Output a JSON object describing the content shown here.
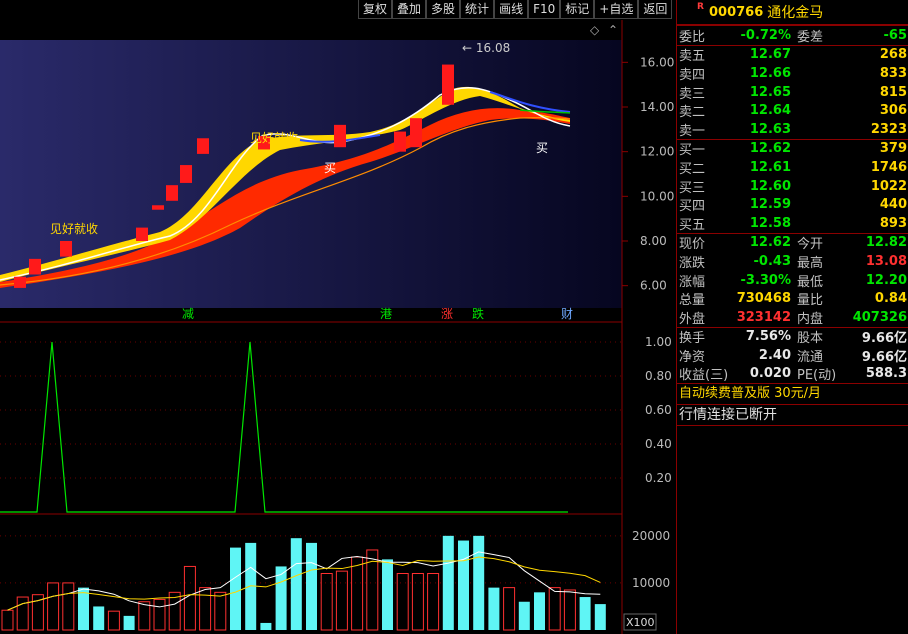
{
  "toolbar": [
    {
      "name": "tb-fuquan",
      "label": "复权"
    },
    {
      "name": "tb-diejia",
      "label": "叠加"
    },
    {
      "name": "tb-duogu",
      "label": "多股"
    },
    {
      "name": "tb-tongji",
      "label": "统计"
    },
    {
      "name": "tb-huaxian",
      "label": "画线"
    },
    {
      "name": "tb-f10",
      "label": "F10"
    },
    {
      "name": "tb-biaoji",
      "label": "标记"
    },
    {
      "name": "tb-zixuan",
      "label": "+自选"
    },
    {
      "name": "tb-fanhui",
      "label": "返回"
    }
  ],
  "stock": {
    "badge": "R",
    "code": "000766",
    "name": "通化金马"
  },
  "weibi": {
    "l1": "委比",
    "v1": "-0.72%",
    "l2": "委差",
    "v2": "-65"
  },
  "asks": [
    {
      "label": "卖五",
      "price": "12.67",
      "vol": "268"
    },
    {
      "label": "卖四",
      "price": "12.66",
      "vol": "833"
    },
    {
      "label": "卖三",
      "price": "12.65",
      "vol": "815"
    },
    {
      "label": "卖二",
      "price": "12.64",
      "vol": "306"
    },
    {
      "label": "卖一",
      "price": "12.63",
      "vol": "2323"
    }
  ],
  "bids": [
    {
      "label": "买一",
      "price": "12.62",
      "vol": "379"
    },
    {
      "label": "买二",
      "price": "12.61",
      "vol": "1746"
    },
    {
      "label": "买三",
      "price": "12.60",
      "vol": "1022"
    },
    {
      "label": "买四",
      "price": "12.59",
      "vol": "440"
    },
    {
      "label": "买五",
      "price": "12.58",
      "vol": "893"
    }
  ],
  "stats": [
    {
      "l1": "现价",
      "v1": "12.62",
      "c1": "green",
      "l2": "今开",
      "v2": "12.82",
      "c2": "green"
    },
    {
      "l1": "涨跌",
      "v1": "-0.43",
      "c1": "green",
      "l2": "最高",
      "v2": "13.08",
      "c2": "red"
    },
    {
      "l1": "涨幅",
      "v1": "-3.30%",
      "c1": "green",
      "l2": "最低",
      "v2": "12.20",
      "c2": "green"
    },
    {
      "l1": "总量",
      "v1": "730468",
      "c1": "yellow",
      "l2": "量比",
      "v2": "0.84",
      "c2": "yellow"
    },
    {
      "l1": "外盘",
      "v1": "323142",
      "c1": "red",
      "l2": "内盘",
      "v2": "407326",
      "c2": "green"
    }
  ],
  "fin": [
    {
      "l1": "换手",
      "v1": "7.56%",
      "l2": "股本",
      "v2": "9.66亿"
    },
    {
      "l1": "净资",
      "v1": "2.40",
      "l2": "流通",
      "v2": "9.66亿"
    },
    {
      "l1": "收益(三)",
      "v1": "0.020",
      "l2": "PE(动)",
      "v2": "588.3"
    }
  ],
  "ad_text": "自动续费普及版  30元/月",
  "connection_status": "行情连接已断开",
  "chart_data": [
    {
      "type": "candlestick",
      "ylim": [
        5.0,
        17.0
      ],
      "yticks": [
        "16.00",
        "14.00",
        "12.00",
        "10.00",
        "8.00",
        "6.00"
      ],
      "yticks_values": [
        16,
        14,
        12,
        10,
        8,
        6
      ],
      "candles": [
        {
          "i": 0,
          "o": 5.9,
          "c": 6.4
        },
        {
          "i": 1,
          "o": 6.5,
          "c": 7.2
        },
        {
          "i": 2,
          "o": 7.3,
          "c": 8.0
        },
        {
          "i": 3,
          "o": 8.0,
          "c": 8.6
        },
        {
          "i": 4,
          "o": 9.4,
          "c": 9.6
        },
        {
          "i": 5,
          "o": 9.8,
          "c": 10.5
        },
        {
          "i": 6,
          "o": 10.6,
          "c": 11.4
        },
        {
          "i": 7,
          "o": 11.9,
          "c": 12.6
        },
        {
          "i": 8,
          "o": 12.1,
          "c": 12.7
        },
        {
          "i": 9,
          "o": 12.2,
          "c": 13.2
        },
        {
          "i": 10,
          "o": 12.0,
          "c": 12.9
        },
        {
          "i": 11,
          "o": 12.2,
          "c": 13.5
        },
        {
          "i": 12,
          "o": 14.1,
          "c": 14.8
        },
        {
          "i": 13,
          "o": 14.4,
          "c": 15.9
        }
      ],
      "annotations": [
        "见好就收",
        "见好就收",
        "买",
        "买",
        "← 16.08"
      ],
      "event_labels": [
        {
          "text": "减",
          "color": "#00e600"
        },
        {
          "text": "港",
          "color": "#00e600"
        },
        {
          "text": "涨",
          "color": "#ff3030"
        },
        {
          "text": "跌",
          "color": "#00e600"
        },
        {
          "text": "财",
          "color": "#6fa8ff"
        }
      ]
    },
    {
      "type": "line",
      "ylim": [
        0,
        1.1
      ],
      "yticks": [
        "1.00",
        "0.80",
        "0.60",
        "0.40",
        "0.20"
      ],
      "yticks_values": [
        1.0,
        0.8,
        0.6,
        0.4,
        0.2
      ],
      "spikes": [
        52,
        250
      ]
    },
    {
      "type": "bar",
      "ylim": [
        0,
        24000
      ],
      "yticks": [
        "20000",
        "10000"
      ],
      "yticks_values": [
        20000,
        10000
      ],
      "unit_label": "X100",
      "values": [
        4200,
        7000,
        7500,
        10000,
        10000,
        9000,
        5000,
        4000,
        3000,
        6000,
        6500,
        8000,
        13500,
        9000,
        8000,
        17500,
        18500,
        1500,
        13500,
        19500,
        18500,
        12000,
        12500,
        15500,
        17000,
        15000,
        12000,
        12000,
        12000,
        20000,
        19000,
        20000,
        9000,
        9000,
        6000,
        8000,
        9000,
        8500,
        7000,
        5500
      ],
      "colors": [
        "r",
        "r",
        "r",
        "r",
        "r",
        "c",
        "c",
        "r",
        "c",
        "r",
        "r",
        "r",
        "r",
        "r",
        "r",
        "c",
        "c",
        "c",
        "c",
        "c",
        "c",
        "r",
        "r",
        "r",
        "r",
        "c",
        "r",
        "r",
        "r",
        "c",
        "c",
        "c",
        "c",
        "r",
        "c",
        "c",
        "r",
        "r",
        "c",
        "c"
      ]
    }
  ]
}
